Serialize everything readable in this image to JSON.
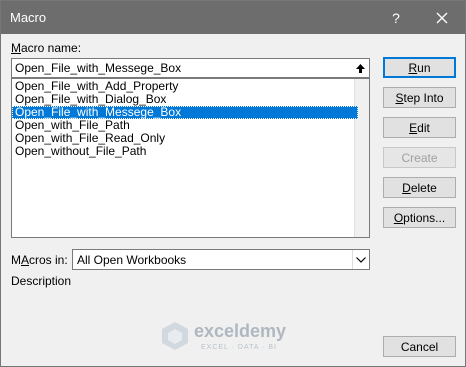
{
  "window": {
    "title": "Macro",
    "help": "?"
  },
  "macro_name": {
    "label_first": "M",
    "label_rest": "acro name:",
    "value": "Open_File_with_Messege_Box"
  },
  "macros": [
    "Open_File_with_Add_Property",
    "Open_File_with_Dialog_Box",
    "Open_File_with_Messege_Box",
    "Open_with_File_Path",
    "Open_with_File_Read_Only",
    "Open_without_File_Path"
  ],
  "selected_index": 2,
  "buttons": {
    "run": {
      "first": "R",
      "rest": "un"
    },
    "step_into": {
      "first": "S",
      "rest": "tep Into"
    },
    "edit": {
      "first": "E",
      "rest": "dit"
    },
    "create": {
      "first": "C",
      "rest": "reate"
    },
    "delete": {
      "first": "D",
      "rest": "elete"
    },
    "options": {
      "first": "O",
      "rest": "ptions..."
    },
    "cancel": "Cancel"
  },
  "macros_in": {
    "label_first": "A",
    "label_rest": "cros in:",
    "label_prefix": "M",
    "value": "All Open Workbooks"
  },
  "description_label": "Description",
  "watermark": {
    "name": "exceldemy",
    "tagline": "EXCEL · DATA · BI"
  },
  "colors": {
    "titlebar": "#6d6d6d",
    "selection": "#0078d7",
    "default_border": "#0078d7"
  }
}
